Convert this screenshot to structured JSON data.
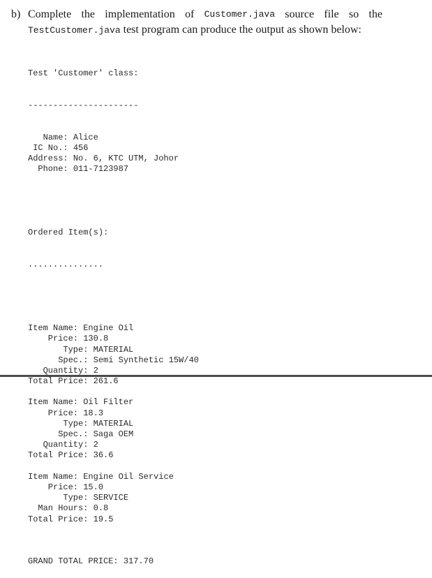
{
  "question": {
    "label": "b)",
    "w1": "Complete",
    "w2": "the",
    "w3": "implementation",
    "w4": "of",
    "code1": "Customer.java",
    "w5": "source",
    "w6": "file",
    "w7": "so",
    "w8": "the",
    "code2": "TestCustomer.java",
    "line2_rest": " test program can produce the output as shown below:"
  },
  "output": {
    "header": "Test 'Customer' class:",
    "header_rule": "----------------------",
    "customer": [
      {
        "label": "   Name: ",
        "value": "Alice"
      },
      {
        "label": " IC No.: ",
        "value": "456"
      },
      {
        "label": "Address: ",
        "value": "No. 6, KTC UTM, Johor"
      },
      {
        "label": "  Phone: ",
        "value": "011-7123987"
      }
    ],
    "items_header": "Ordered Item(s):",
    "items_rule": "...............",
    "items": [
      {
        "lines": [
          {
            "label": "Item Name: ",
            "value": "Engine Oil"
          },
          {
            "label": "    Price: ",
            "value": "130.8"
          },
          {
            "label": "       Type: ",
            "value": "MATERIAL"
          },
          {
            "label": "      Spec.: ",
            "value": "Semi Synthetic 15W/40"
          },
          {
            "label": "   Quantity: ",
            "value": "2"
          },
          {
            "label": "Total Price: ",
            "value": "261.6"
          }
        ]
      },
      {
        "lines": [
          {
            "label": "Item Name: ",
            "value": "Oil Filter"
          },
          {
            "label": "    Price: ",
            "value": "18.3"
          },
          {
            "label": "       Type: ",
            "value": "MATERIAL"
          },
          {
            "label": "      Spec.: ",
            "value": "Saga OEM"
          },
          {
            "label": "   Quantity: ",
            "value": "2"
          },
          {
            "label": "Total Price: ",
            "value": "36.6"
          }
        ]
      },
      {
        "lines": [
          {
            "label": "Item Name: ",
            "value": "Engine Oil Service"
          },
          {
            "label": "    Price: ",
            "value": "15.0"
          },
          {
            "label": "       Type: ",
            "value": "SERVICE"
          },
          {
            "label": "  Man Hours: ",
            "value": "0.8"
          },
          {
            "label": "Total Price: ",
            "value": "19.5"
          }
        ]
      }
    ],
    "grand_total_label": "GRAND TOTAL PRICE: ",
    "grand_total_value": "317.70"
  }
}
